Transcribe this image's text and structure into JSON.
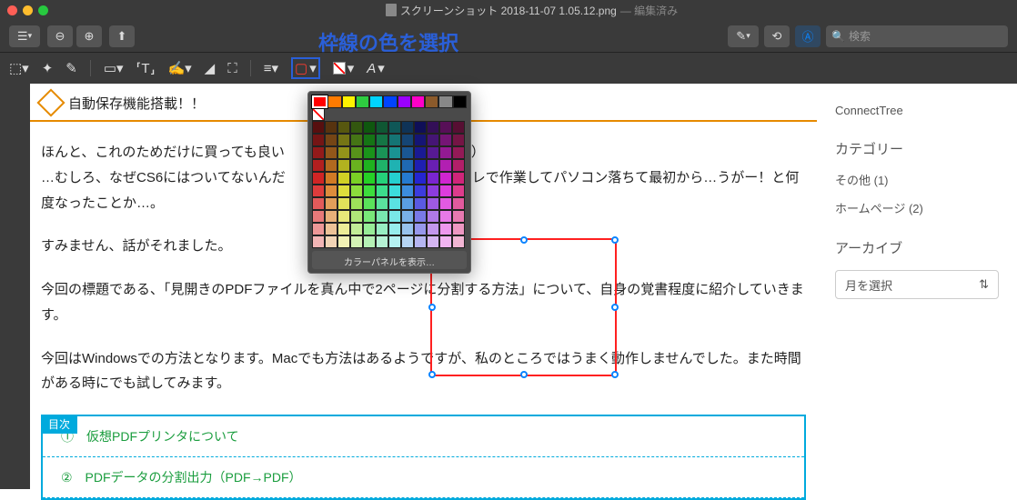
{
  "window": {
    "file_name": "スクリーンショット 2018-11-07 1.05.12.png",
    "edited_suffix": "— 編集済み"
  },
  "overlay_label": "枠線の色を選択",
  "search": {
    "placeholder": "検索"
  },
  "sidebar": {
    "title_link": "ConnectTree",
    "category_h": "カテゴリー",
    "cat_items": [
      "その他 (1)",
      "ホームページ (2)"
    ],
    "archive_h": "アーカイブ",
    "archive_select": "月を選択"
  },
  "doc": {
    "heading": "自動保存機能搭載！！",
    "p1_a": "ほんと、これのためだけに買っても良い",
    "p1_b": "ら）",
    "p2_a": "…むしろ、なぜCS6にはついてないんだ",
    "p2_b": "ラレで作業してパソコン落ちて最初から…うがー！と何度なったことか…。",
    "p3": "すみません、話がそれました。",
    "p4": "今回の標題である、「見開きのPDFファイルを真ん中で2ページに分割する方法」について、自身の覚書程度に紹介していきます。",
    "p5": "今回はWindowsでの方法となります。Macでも方法はあるようですが、私のところではうまく動作しませんでした。また時間がある時にでも試してみます。"
  },
  "toc": {
    "label": "目次",
    "items": [
      "①　仮想PDFプリンタについて",
      "②　PDFデータの分割出力（PDF→PDF）"
    ]
  },
  "color_picker": {
    "selected": "#ff0000",
    "top_row": [
      "#ff0000",
      "#ff7b00",
      "#fff200",
      "#2ecc40",
      "#00d4ff",
      "#0044ff",
      "#9b00ff",
      "#ff00c8",
      "#8b5a2b",
      "#888888",
      "#000000"
    ],
    "footer": "カラーパネルを表示…"
  },
  "icons": {
    "sidebar_btn": "☰",
    "zoom_out": "−",
    "zoom_in": "＋",
    "share": "⇪",
    "pen": "✎",
    "shape": "⬚",
    "info_a": "ⓐ",
    "lasso": "⬚",
    "wand": "✦",
    "pencil": "✎",
    "shape2": "▭",
    "text": "T",
    "sign": "✍",
    "highlight": "▲",
    "crop": "⛶",
    "line_w": "≡",
    "border": "▢",
    "fill": "▨",
    "font": "A"
  }
}
